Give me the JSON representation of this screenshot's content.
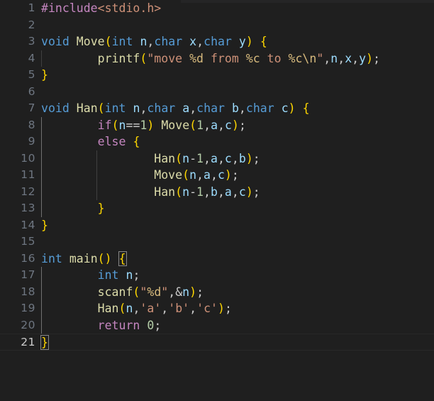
{
  "editor": {
    "language": "c",
    "theme": "Dark Modern",
    "background": "#1f1f1f",
    "gutter_color": "#6e7681",
    "active_line_number": 21,
    "total_lines": 21,
    "font_size_px": 16.5,
    "line_height_px": 23.5
  },
  "colors": {
    "keyword": "#569cd6",
    "control": "#c586c0",
    "function": "#dcdcaa",
    "variable": "#9cdcfe",
    "number": "#b5cea8",
    "string": "#ce9178",
    "escape": "#d7ba7d",
    "plain": "#cccccc",
    "bracket1": "#ffd700",
    "bracket2": "#da70d6",
    "bracket3": "#179fff",
    "indent_guide": "#404040",
    "indent_guide_active": "#707070"
  },
  "gutter": {
    "numbers": [
      "1",
      "2",
      "3",
      "4",
      "5",
      "6",
      "7",
      "8",
      "9",
      "10",
      "11",
      "12",
      "13",
      "14",
      "15",
      "16",
      "17",
      "18",
      "19",
      "20",
      "21"
    ]
  },
  "code": {
    "raw_text": "#include<stdio.h>\n\nvoid Move(int n,char x,char y) {\n        printf(\"move %d from %c to %c\\n\",n,x,y);\n}\n\nvoid Han(int n,char a,char b,char c) {\n        if(n==1) Move(1,a,c);\n        else {\n                Han(n-1,a,c,b);\n                Move(n,a,c);\n                Han(n-1,b,a,c);\n        }\n}\n\nint main() {\n        int n;\n        scanf(\"%d\",&n);\n        Han(n,'a','b','c');\n        return 0;\n}",
    "lines": [
      {
        "n": "1",
        "text": "#include<stdio.h>"
      },
      {
        "n": "2",
        "text": ""
      },
      {
        "n": "3",
        "text": "void Move(int n,char x,char y) {"
      },
      {
        "n": "4",
        "text": "        printf(\"move %d from %c to %c\\n\",n,x,y);"
      },
      {
        "n": "5",
        "text": "}"
      },
      {
        "n": "6",
        "text": ""
      },
      {
        "n": "7",
        "text": "void Han(int n,char a,char b,char c) {"
      },
      {
        "n": "8",
        "text": "        if(n==1) Move(1,a,c);"
      },
      {
        "n": "9",
        "text": "        else {"
      },
      {
        "n": "10",
        "text": "                Han(n-1,a,c,b);"
      },
      {
        "n": "11",
        "text": "                Move(n,a,c);"
      },
      {
        "n": "12",
        "text": "                Han(n-1,b,a,c);"
      },
      {
        "n": "13",
        "text": "        }"
      },
      {
        "n": "14",
        "text": "}"
      },
      {
        "n": "15",
        "text": ""
      },
      {
        "n": "16",
        "text": "int main() {"
      },
      {
        "n": "17",
        "text": "        int n;"
      },
      {
        "n": "18",
        "text": "        scanf(\"%d\",&n);"
      },
      {
        "n": "19",
        "text": "        Han(n,'a','b','c');"
      },
      {
        "n": "20",
        "text": "        return 0;"
      },
      {
        "n": "21",
        "text": "}"
      }
    ]
  }
}
